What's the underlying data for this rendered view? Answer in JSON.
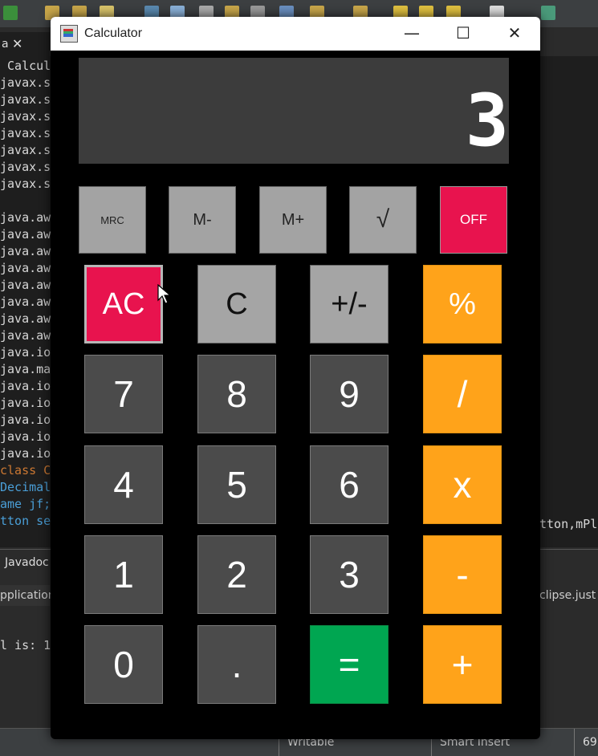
{
  "ide": {
    "tab_name": "a",
    "tab_close": "✕",
    "code_lines": [
      " Calcul",
      "javax.s",
      "javax.s",
      "javax.s",
      "javax.s",
      "javax.s",
      "javax.s",
      "javax.s",
      "",
      "java.aw",
      "java.aw",
      "java.aw",
      "java.aw",
      "java.aw",
      "java.aw",
      "java.aw",
      "java.aw",
      "java.io",
      "java.ma",
      "java.io",
      "java.io",
      "java.io",
      "java.io",
      "java.io",
      "class C",
      "Decimal",
      "ame jf;",
      "tton se"
    ],
    "code_right": "tton,mPl",
    "console_tab": "Javadoc",
    "console_sub": "pplication",
    "console_right": "clipse.just",
    "console_out": "l is: 1",
    "status": [
      "Writable",
      "Smart Insert",
      "69"
    ]
  },
  "calculator": {
    "title": "Calculator",
    "controls": {
      "minimize": "—",
      "maximize": "☐",
      "close": "✕"
    },
    "display_value": "3",
    "memory_buttons": [
      "MRC",
      "M-",
      "M+",
      "√",
      "OFF"
    ],
    "keys": {
      "ac": "AC",
      "c": "C",
      "sign": "+/-",
      "percent": "%",
      "seven": "7",
      "eight": "8",
      "nine": "9",
      "divide": "/",
      "four": "4",
      "five": "5",
      "six": "6",
      "multiply": "x",
      "one": "1",
      "two": "2",
      "three": "3",
      "minus": "-",
      "zero": "0",
      "dot": ".",
      "equals": "=",
      "plus": "+"
    }
  }
}
